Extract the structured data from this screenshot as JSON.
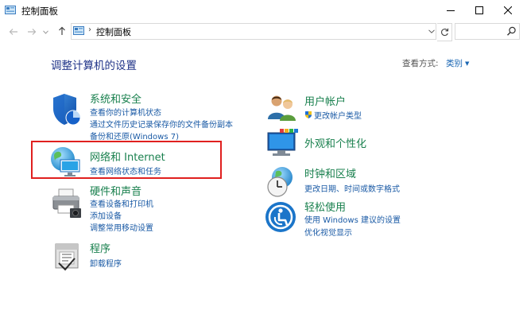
{
  "window": {
    "title": "控制面板",
    "minimize_label": "minimize",
    "maximize_label": "maximize",
    "close_label": "close"
  },
  "nav": {
    "breadcrumb_sep": "›",
    "breadcrumb": "控制面板",
    "search_placeholder": ""
  },
  "content": {
    "heading": "调整计算机的设置",
    "view_by_label": "查看方式:",
    "view_by_value": "类别"
  },
  "left_categories": [
    {
      "title": "系统和安全",
      "links": [
        "查看你的计算机状态",
        "通过文件历史记录保存你的文件备份副本",
        "备份和还原(Windows 7)"
      ]
    },
    {
      "title": "网络和 Internet",
      "links": [
        "查看网络状态和任务"
      ]
    },
    {
      "title": "硬件和声音",
      "links": [
        "查看设备和打印机",
        "添加设备",
        "调整常用移动设置"
      ]
    },
    {
      "title": "程序",
      "links": [
        "卸载程序"
      ]
    }
  ],
  "right_categories": [
    {
      "title": "用户帐户",
      "links": [
        "更改帐户类型"
      ]
    },
    {
      "title": "外观和个性化",
      "links": []
    },
    {
      "title": "时钟和区域",
      "links": [
        "更改日期、时间或数字格式"
      ]
    },
    {
      "title": "轻松使用",
      "links": [
        "使用 Windows 建议的设置",
        "优化视觉显示"
      ]
    }
  ],
  "colors": {
    "category_title": "#19804e",
    "link": "#1a5aa5",
    "heading": "#1e3287",
    "highlight": "#e0201f"
  }
}
